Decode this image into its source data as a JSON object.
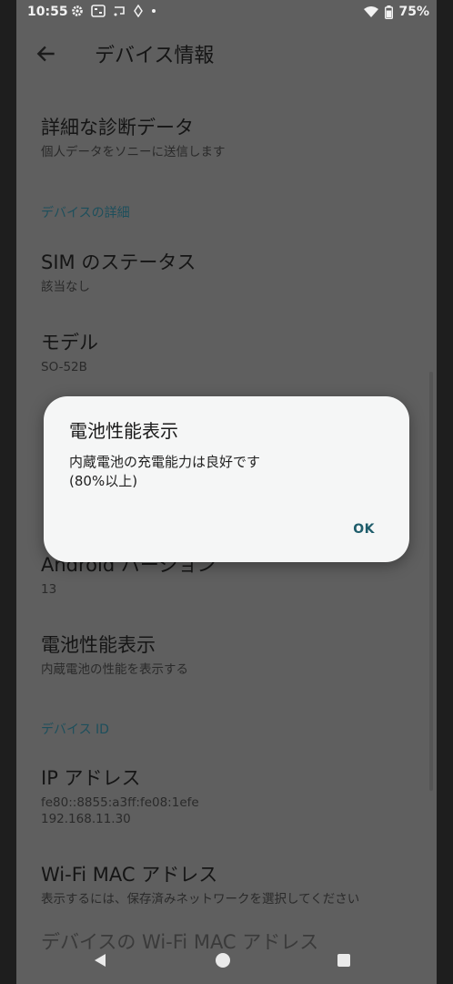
{
  "status": {
    "time": "10:55",
    "battery": "75%"
  },
  "header": {
    "title": "デバイス情報"
  },
  "items": {
    "diag": {
      "title": "詳細な診断データ",
      "subtitle": "個人データをソニーに送信します"
    },
    "section_details": "デバイスの詳細",
    "sim": {
      "title": "SIM のステータス",
      "subtitle": "該当なし"
    },
    "model": {
      "title": "モデル",
      "subtitle": "SO-52B"
    },
    "android": {
      "title": "Android バージョン",
      "subtitle": "13"
    },
    "battery": {
      "title": "電池性能表示",
      "subtitle": "内蔵電池の性能を表示する"
    },
    "section_id": "デバイス ID",
    "ip": {
      "title": "IP アドレス",
      "line1": "fe80::8855:a3ff:fe08:1efe",
      "line2": "192.168.11.30"
    },
    "wifi_mac": {
      "title": "Wi-Fi MAC アドレス",
      "subtitle": "表示するには、保存済みネットワークを選択してください"
    },
    "device_wifi_mac": {
      "title": "デバイスの Wi-Fi MAC アドレス"
    }
  },
  "dialog": {
    "title": "電池性能表示",
    "message_line1": "内蔵電池の充電能力は良好です",
    "message_line2": "(80%以上)",
    "ok_label": "OK"
  }
}
